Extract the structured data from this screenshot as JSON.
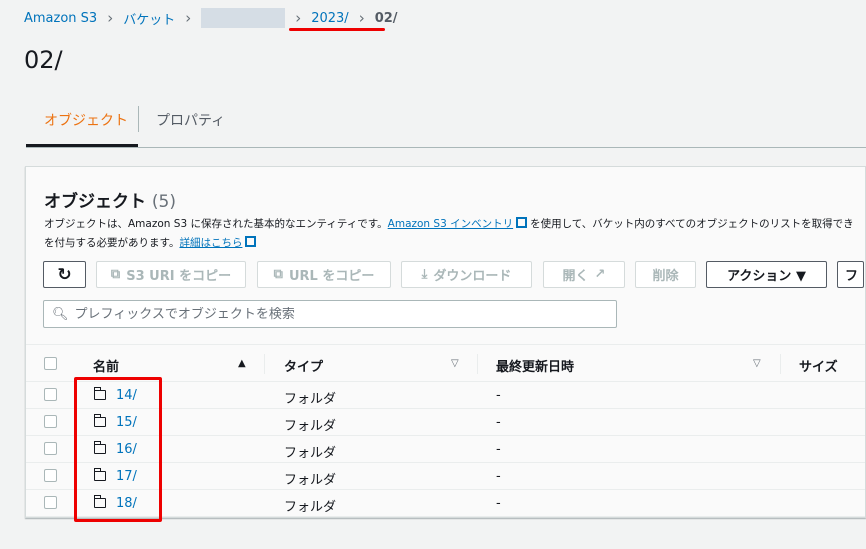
{
  "breadcrumb": {
    "items": [
      "Amazon S3",
      "バケット",
      "2023/"
    ],
    "current": "02/"
  },
  "page_title": "02/",
  "tabs": [
    "オブジェクト",
    "プロパティ"
  ],
  "panel": {
    "title": "オブジェクト",
    "count": "(5)",
    "desc_1": "オブジェクトは、Amazon S3 に保存された基本的なエンティティです。",
    "desc_link": "Amazon S3 インベントリ",
    "desc_2": "を使用して、バケット内のすべてのオブジェクトのリストを取得でき",
    "desc_3": "を付与する必要があります。",
    "desc_link2": "詳細はこちら"
  },
  "toolbar": {
    "copy_s3_uri": "S3 URI をコピー",
    "copy_url": "URL をコピー",
    "download": "ダウンロード",
    "open": "開く",
    "delete": "削除",
    "actions": "アクション ▼",
    "more": "フ"
  },
  "search": {
    "placeholder": "プレフィックスでオブジェクトを検索"
  },
  "table": {
    "headers": [
      "名前",
      "タイプ",
      "最終更新日時",
      "サイズ"
    ],
    "rows": [
      {
        "name": "14/",
        "type": "フォルダ",
        "modified": "-"
      },
      {
        "name": "15/",
        "type": "フォルダ",
        "modified": "-"
      },
      {
        "name": "16/",
        "type": "フォルダ",
        "modified": "-"
      },
      {
        "name": "17/",
        "type": "フォルダ",
        "modified": "-"
      },
      {
        "name": "18/",
        "type": "フォルダ",
        "modified": "-"
      }
    ]
  },
  "colors": {
    "link": "#0073bb",
    "active_tab": "#ec7211",
    "annotation": "#e00000"
  }
}
